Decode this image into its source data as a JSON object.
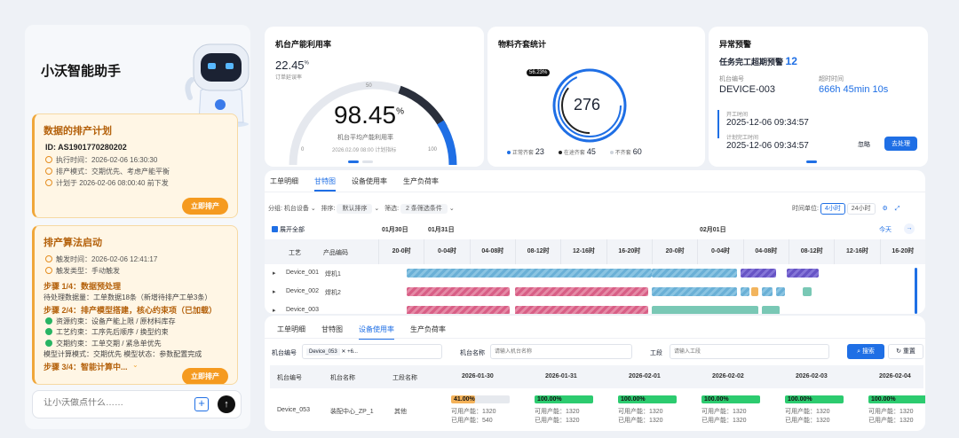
{
  "assistant": {
    "title": "小沃智能助手",
    "card1": {
      "title": "数据的排产计划",
      "id": "ID: AS1901770280202",
      "exec_time": "执行时间：2026-02-06 16:30:30",
      "mode": "排产模式：交期优先、考虑产能平衡",
      "plan": "计划于 2026-02-06 08:00:40 前下发",
      "button": "立即排产"
    },
    "card2": {
      "title": "排产算法启动",
      "trigger_time": "触发时间：2026-02-06 12:41:17",
      "trigger_type": "触发类型：手动触发",
      "step1": "步骤 1/4：数据预处理",
      "step1_desc": "待处理数据量：工单数据18条（新增待排产工单3条）",
      "step2": "步骤 2/4：排产模型搭建，核心约束项（已加载）",
      "constraints": [
        "资源约束：设备产能上限 / 原材料库存",
        "工艺约束：工序先后顺序 / 换型约束",
        "交期约束：工单交期 / 紧急单优先"
      ],
      "mode_line": "模型计算模式：交期优先   模型状态：参数配置完成",
      "step3": "步骤 3/4：智能计算中...",
      "button": "立即排产"
    },
    "input_placeholder": "让小沃做点什么……"
  },
  "util_card": {
    "title": "机台产能利用率",
    "small_value": "22.45",
    "small_unit": "%",
    "small_label": "订单延误率",
    "value": "98.45",
    "unit": "%",
    "label": "机台平均产能利用率",
    "time": "2026.02.09 08:00 计划指标",
    "ticks": [
      "0",
      "50",
      "100"
    ],
    "gauge_fraction": 0.9845
  },
  "material_card": {
    "title": "物料齐套统计",
    "tooltip": "56.23%",
    "total": "276",
    "legend": [
      {
        "label": "正常齐套",
        "value": "23",
        "color": "#1f6fe5"
      },
      {
        "label": "在途齐套",
        "value": "45",
        "color": "#222"
      },
      {
        "label": "不齐套",
        "value": "60",
        "color": "#cfd4dc"
      }
    ]
  },
  "alert_card": {
    "title": "异常预警",
    "subtitle": "任务完工超期预警",
    "count": "12",
    "device_label": "机台编号",
    "device": "DEVICE-003",
    "overtime_label": "超时时间",
    "overtime": "666h 45min 10s",
    "start_label": "开工时间",
    "start": "2025-12-06 09:34:57",
    "plan_label": "计划完工时间",
    "plan": "2025-12-06 09:34:57",
    "ignore": "忽略",
    "handle": "去处理"
  },
  "gantt": {
    "tabs": [
      "工单明细",
      "甘特图",
      "设备使用率",
      "生产负荷率"
    ],
    "active_tab": "甘特图",
    "group_label": "分组:",
    "group_value": "机台设备",
    "sort_label": "排序:",
    "sort_value": "默认排序",
    "filter_label": "筛选:",
    "filter_value": "2 条筛选条件",
    "unit_label": "时间单位:",
    "unit_options": [
      "4小时",
      "24小时"
    ],
    "unit_active": "4小时",
    "today": "今天",
    "expand": "展开全部",
    "col_process": "工艺",
    "col_product": "产品编码",
    "dates": [
      "01月30日",
      "01月31日",
      "02月01日"
    ],
    "hours": [
      "20-0时",
      "0-04时",
      "04-08时",
      "08-12时",
      "12-16时",
      "16-20时",
      "20-0时",
      "0-04时",
      "04-08时",
      "08-12时",
      "12-16时",
      "16-20时"
    ],
    "rows": [
      {
        "device": "Device_001",
        "product": "焊机1"
      },
      {
        "device": "Device_002",
        "product": "焊机2"
      },
      {
        "device": "Device_003",
        "product": ""
      }
    ]
  },
  "usage": {
    "tabs": [
      "工单明细",
      "甘特图",
      "设备使用率",
      "生产负荷率"
    ],
    "active_tab": "设备使用率",
    "device_label": "机台编号",
    "device_tag": "Device_053",
    "device_more": "+6...",
    "name_label": "机台名称",
    "name_placeholder": "请输入机台名称",
    "process_label": "工段",
    "process_placeholder": "请输入工段",
    "search": "搜索",
    "reset": "重置",
    "headers": [
      "机台编号",
      "机台名称",
      "工段名称"
    ],
    "dates": [
      "2026-01-30",
      "2026-01-31",
      "2026-02-01",
      "2026-02-02",
      "2026-02-03",
      "2026-02-04"
    ],
    "row": {
      "id": "Device_053",
      "name": "装配中心_ZP_1",
      "process": "其他"
    },
    "cells": [
      {
        "pct": "41.00%",
        "fraction": 0.41,
        "avail": "可用产能：1320",
        "used": "已用产能：540"
      },
      {
        "pct": "100.00%",
        "fraction": 1,
        "avail": "可用产能：1320",
        "used": "已用产能：1320"
      },
      {
        "pct": "100.00%",
        "fraction": 1,
        "avail": "可用产能：1320",
        "used": "已用产能：1320"
      },
      {
        "pct": "100.00%",
        "fraction": 1,
        "avail": "可用产能：1320",
        "used": "已用产能：1320"
      },
      {
        "pct": "100.00%",
        "fraction": 1,
        "avail": "可用产能：1320",
        "used": "已用产能：1320"
      },
      {
        "pct": "100.00%",
        "fraction": 1,
        "avail": "可用产能：1320",
        "used": "已用产能：1320"
      }
    ]
  }
}
